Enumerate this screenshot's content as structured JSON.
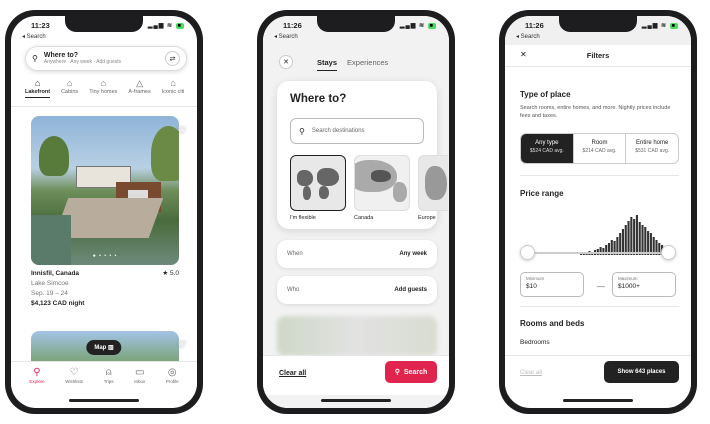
{
  "phone1": {
    "time": "11:23",
    "back": "◂ Search",
    "search": {
      "title": "Where to?",
      "subtitle": "Anywhere · Any week · Add guests"
    },
    "categories": [
      {
        "label": "Lakefront",
        "icon": "lakefront-icon"
      },
      {
        "label": "Cabins",
        "icon": "cabin-icon"
      },
      {
        "label": "Tiny homes",
        "icon": "tiny-home-icon"
      },
      {
        "label": "A-frames",
        "icon": "a-frame-icon"
      },
      {
        "label": "Iconic citi",
        "icon": "iconic-cities-icon"
      }
    ],
    "listing": {
      "city": "Innisfil, Canada",
      "rating": "★ 5.0",
      "area": "Lake Simcoe",
      "dates": "Sep. 19 – 24",
      "price": "$4,123 CAD night"
    },
    "map_button": "Map",
    "tabs": [
      "Explore",
      "Wishlists",
      "Trips",
      "Inbox",
      "Profile"
    ]
  },
  "phone2": {
    "time": "11:26",
    "back": "◂ Search",
    "tabs": [
      "Stays",
      "Experiences"
    ],
    "heading": "Where to?",
    "search_placeholder": "Search destinations",
    "regions": [
      "I'm flexible",
      "Canada",
      "Europe"
    ],
    "when": {
      "label": "When",
      "value": "Any week"
    },
    "who": {
      "label": "Who",
      "value": "Add guests"
    },
    "clear_all": "Clear all",
    "search_button": "Search"
  },
  "phone3": {
    "time": "11:26",
    "back": "◂ Search",
    "title": "Filters",
    "type_of_place": {
      "title": "Type of place",
      "desc": "Search rooms, entire homes, and more. Nightly prices include fees and taxes.",
      "options": [
        {
          "label": "Any type",
          "sub": "$524 CAD avg."
        },
        {
          "label": "Room",
          "sub": "$214 CAD avg."
        },
        {
          "label": "Entire home",
          "sub": "$531 CAD avg."
        }
      ]
    },
    "price_range": {
      "title": "Price range",
      "min_label": "Minimum",
      "min_value": "$10",
      "max_label": "Maximum",
      "max_value": "$1000+"
    },
    "rooms": {
      "title": "Rooms and beds",
      "sub": "Bedrooms"
    },
    "clear_all": "Clear all",
    "show_button": "Show 643 places"
  },
  "histogram_levels": [
    2,
    3,
    2,
    4,
    3,
    5,
    6,
    8,
    7,
    10,
    12,
    15,
    14,
    18,
    22,
    26,
    30,
    34,
    38,
    36,
    40,
    33,
    30,
    28,
    24,
    22,
    18,
    15,
    12,
    10,
    8,
    6,
    5,
    4
  ]
}
